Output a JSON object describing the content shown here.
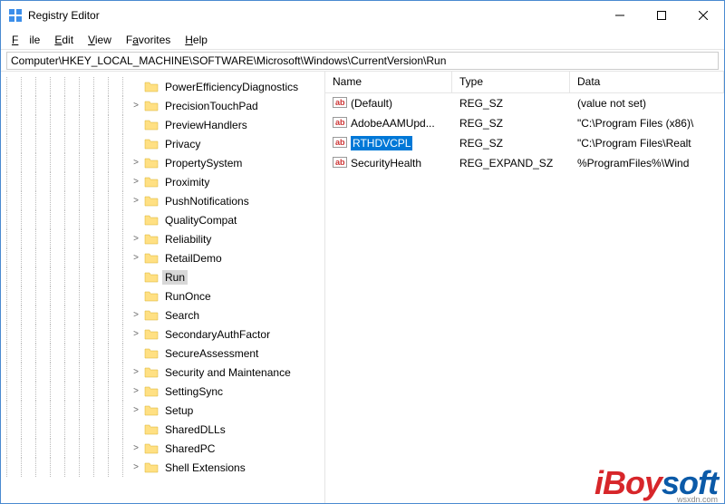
{
  "window": {
    "title": "Registry Editor"
  },
  "menu": {
    "file": "File",
    "edit": "Edit",
    "view": "View",
    "favorites": "Favorites",
    "help": "Help"
  },
  "address": {
    "value": "Computer\\HKEY_LOCAL_MACHINE\\SOFTWARE\\Microsoft\\Windows\\CurrentVersion\\Run"
  },
  "tree": {
    "nodes": [
      {
        "label": "PowerEfficiencyDiagnostics",
        "depth": 9,
        "exp": "",
        "selected": false
      },
      {
        "label": "PrecisionTouchPad",
        "depth": 9,
        "exp": ">",
        "selected": false
      },
      {
        "label": "PreviewHandlers",
        "depth": 9,
        "exp": "",
        "selected": false
      },
      {
        "label": "Privacy",
        "depth": 9,
        "exp": "",
        "selected": false
      },
      {
        "label": "PropertySystem",
        "depth": 9,
        "exp": ">",
        "selected": false
      },
      {
        "label": "Proximity",
        "depth": 9,
        "exp": ">",
        "selected": false
      },
      {
        "label": "PushNotifications",
        "depth": 9,
        "exp": ">",
        "selected": false
      },
      {
        "label": "QualityCompat",
        "depth": 9,
        "exp": "",
        "selected": false
      },
      {
        "label": "Reliability",
        "depth": 9,
        "exp": ">",
        "selected": false
      },
      {
        "label": "RetailDemo",
        "depth": 9,
        "exp": ">",
        "selected": false
      },
      {
        "label": "Run",
        "depth": 9,
        "exp": "",
        "selected": true
      },
      {
        "label": "RunOnce",
        "depth": 9,
        "exp": "",
        "selected": false
      },
      {
        "label": "Search",
        "depth": 9,
        "exp": ">",
        "selected": false
      },
      {
        "label": "SecondaryAuthFactor",
        "depth": 9,
        "exp": ">",
        "selected": false
      },
      {
        "label": "SecureAssessment",
        "depth": 9,
        "exp": "",
        "selected": false
      },
      {
        "label": "Security and Maintenance",
        "depth": 9,
        "exp": ">",
        "selected": false
      },
      {
        "label": "SettingSync",
        "depth": 9,
        "exp": ">",
        "selected": false
      },
      {
        "label": "Setup",
        "depth": 9,
        "exp": ">",
        "selected": false
      },
      {
        "label": "SharedDLLs",
        "depth": 9,
        "exp": "",
        "selected": false
      },
      {
        "label": "SharedPC",
        "depth": 9,
        "exp": ">",
        "selected": false
      },
      {
        "label": "Shell Extensions",
        "depth": 9,
        "exp": ">",
        "selected": false
      }
    ]
  },
  "list": {
    "headers": {
      "name": "Name",
      "type": "Type",
      "data": "Data"
    },
    "rows": [
      {
        "name": "(Default)",
        "type": "REG_SZ",
        "data": "(value not set)",
        "selected": false
      },
      {
        "name": "AdobeAAMUpd...",
        "type": "REG_SZ",
        "data": "\"C:\\Program Files (x86)\\",
        "selected": false
      },
      {
        "name": "RTHDVCPL",
        "type": "REG_SZ",
        "data": "\"C:\\Program Files\\Realt",
        "selected": true
      },
      {
        "name": "SecurityHealth",
        "type": "REG_EXPAND_SZ",
        "data": "%ProgramFiles%\\Wind",
        "selected": false
      }
    ]
  },
  "watermark": {
    "text_pre": "iBoy",
    "text_suf": "soft",
    "src": "wsxdn.com"
  }
}
